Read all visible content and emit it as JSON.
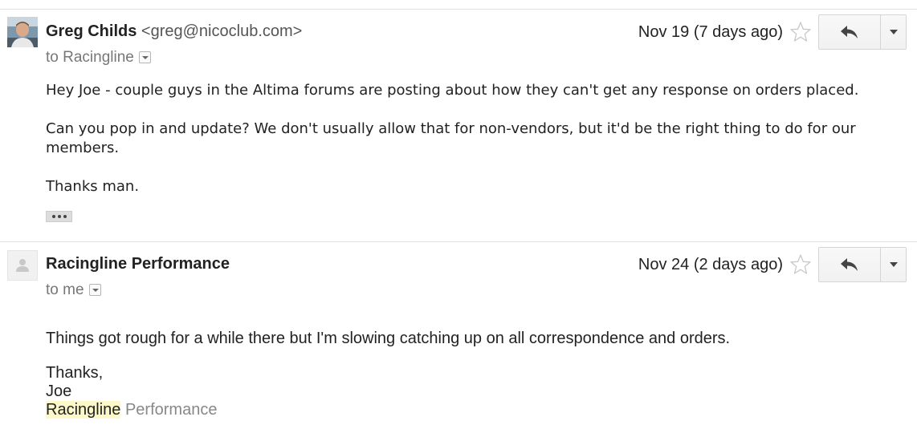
{
  "messages": [
    {
      "sender_name": "Greg Childs",
      "sender_email": "<greg@nicoclub.com>",
      "recipient": "to Racingline",
      "date": "Nov 19 (7 days ago)",
      "body": [
        "Hey Joe - couple guys in the Altima forums are posting about how they can't get any response on orders placed.",
        "Can you pop in and update?  We don't usually allow that for non-vendors, but it'd be the right thing to do for our members.",
        "Thanks man."
      ],
      "avatar_icon": "user-photo-icon"
    },
    {
      "sender_name": "Racingline Performance",
      "recipient": "to me",
      "date": "Nov 24 (2 days ago)",
      "body": [
        "Things got rough for a while there but I'm slowing catching up on all correspondence and orders."
      ],
      "signature": {
        "thanks": "Thanks,",
        "name": "Joe",
        "company_highlight": "Racingline",
        "company_rest": "Performance"
      },
      "avatar_icon": "default-avatar-icon"
    }
  ],
  "icons": {
    "star": "star-outline-icon",
    "reply": "reply-icon",
    "more": "chevron-down-icon",
    "show_trimmed": "ellipsis-icon"
  },
  "colors": {
    "highlight": "#fcf8c8",
    "muted": "#777777",
    "divider": "#e0e0e0"
  }
}
